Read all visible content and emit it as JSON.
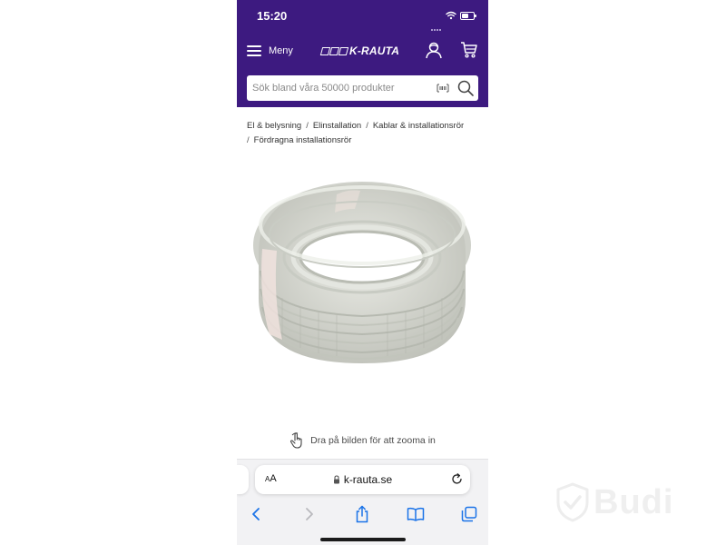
{
  "status_bar": {
    "time": "15:20"
  },
  "header": {
    "menu_label": "Meny",
    "logo_text": "K-RAUTA",
    "brand_color": "#3d1a80",
    "search": {
      "placeholder": "Sök bland våra 50000 produkter"
    }
  },
  "breadcrumb": {
    "items": [
      "El & belysning",
      "Elinstallation",
      "Kablar & installationsrör",
      "Fördragna installationsrör"
    ]
  },
  "product": {
    "image_icon": "coiled-conduit-image",
    "zoom_hint": "Dra på bilden för att zooma in"
  },
  "browser": {
    "text_size_label": "AA",
    "url": "k-rauta.se",
    "toolbar_icons": [
      "back-icon",
      "forward-icon",
      "share-icon",
      "bookmarks-icon",
      "tabs-icon"
    ],
    "accent_color": "#1a73e8"
  },
  "watermark": {
    "text": "Budi"
  }
}
